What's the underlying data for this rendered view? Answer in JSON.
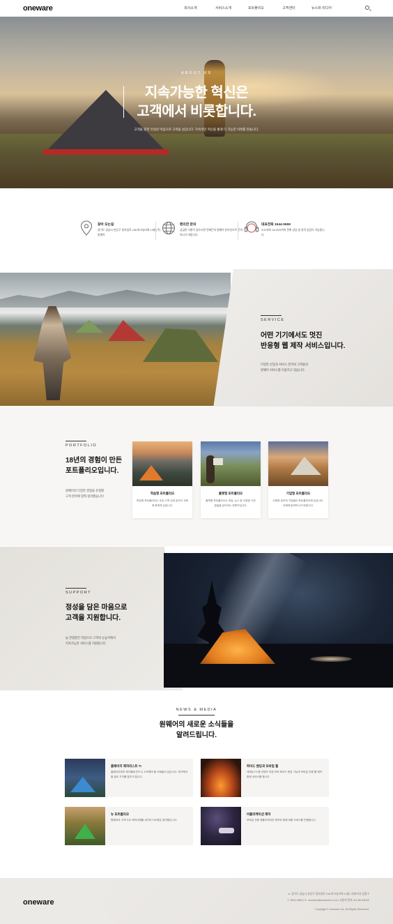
{
  "header": {
    "logo": "oneware",
    "nav": [
      "회사소개",
      "서비스소개",
      "포트폴리오",
      "고객센터",
      "뉴스와 미디어"
    ]
  },
  "hero": {
    "eyebrow": "ABOUT US",
    "title_line1": "지속가능한 혁신은",
    "title_line2": "고객에서 비롯합니다.",
    "subtitle": "고객을 향한 진실된 마음으로 고객을 섬깁니다. 지속적인 혁신을 통해 더 가능한 미래를 만듭니다."
  },
  "contact": [
    {
      "title": "찾아 오는길",
      "desc": "경기도 성남시 분당구 정자일로 248 파크뷰타워 13층 (주)원웨어",
      "icon": "map-pin-icon"
    },
    {
      "title": "편리한 문의",
      "desc": "궁금한 사항이 있으시면 언제든지 원웨어 온라인으로 문의하시기 바랍니다.",
      "icon": "globe-icon"
    },
    {
      "title": "대표전화 1544-0659",
      "desc": "9:00부터 18:00시까지 전화 상담 및 원격 상담이 가능합니다.",
      "icon": "headset-icon"
    }
  ],
  "service": {
    "eyebrow": "SERVICE",
    "title_line1": "어떤 기기에서도 멋진",
    "title_line2": "반응형 웹 제작 서비스입니다.",
    "desc_line1": "다양한 산업과 서비스 분야의 고객들의",
    "desc_line2": "원웨어 서비스를 이용하고 있습니다."
  },
  "portfolio": {
    "eyebrow": "PORTFOLIO",
    "title_line1": "18년의 경험이 만든",
    "title_line2": "포트폴리오입니다.",
    "desc_line1": "원웨어의 다양한 경험을 유형별",
    "desc_line2": "고객 분야에 맞춰 정리했습니다.",
    "cards": [
      {
        "title": "학습형 포트폴리오",
        "desc": "학습형 포트폴리오는 주로 고객 산업 분야가 교육에 맞춰져 있습니다."
      },
      {
        "title": "플랫형 포트폴리오",
        "desc": "플랫형 포트폴리오는 게임, 뉴스 등 다양한 기관 분들을 유도하는 컨텐츠입니다."
      },
      {
        "title": "기업형 포트폴리오",
        "desc": "다양한 분야의 기업들이 포트폴리오에 있습니다. 아래에 알려보시기 바랍니다."
      }
    ]
  },
  "support": {
    "eyebrow": "SUPPORT",
    "title_line1": "정성을 담은 마음으로",
    "title_line2": "고객을 지원합니다.",
    "desc_line1": "늘 한결같은 마음으로 고객의 눈높이에서",
    "desc_line2": "지속가능한 서비스를 지원합니다."
  },
  "news": {
    "eyebrow": "NEWS & MEDIA",
    "title_line1": "원웨어의 새로운 소식들을",
    "title_line2": "알려드립니다.",
    "items": [
      {
        "title": "홈페이지 제작리스트 TI",
        "desc": "홈페이지제작 체크할때 반드시 고려해야 할 사항들이 있습니다. 체크해야할 필요 가지를 알려 드립니다."
      },
      {
        "title": "파이드 렌딩과 모바일 웹",
        "desc": "대체로 PC용 컨텐츠 의한 보여 파이드 렌딩 기능과 모바일 전용 웹 제작 함께 서비스를 합니다."
      },
      {
        "title": "뉴 포트폴리오",
        "desc": "원웨어의 고객 주요 제작사례를 새기의 이소펜은 정리했습니다."
      },
      {
        "title": "어플리케이션 제작",
        "desc": "모바일 전용 애플리케이션 제작과 함께 대행 서비스를 진행합니다."
      }
    ]
  },
  "footer": {
    "logo": "oneware",
    "line1": "A. 경기도 성남시 분당구 정자일로 248 파크뷰타워 13층  |  대표이사 김원구",
    "line2": "T. 1544-0659  |  E. oneware@oneware.co.kr  |  사업자 번호 111-86-48020",
    "copyright": "Copyright © oneware Inc. All Rights Reserved."
  }
}
